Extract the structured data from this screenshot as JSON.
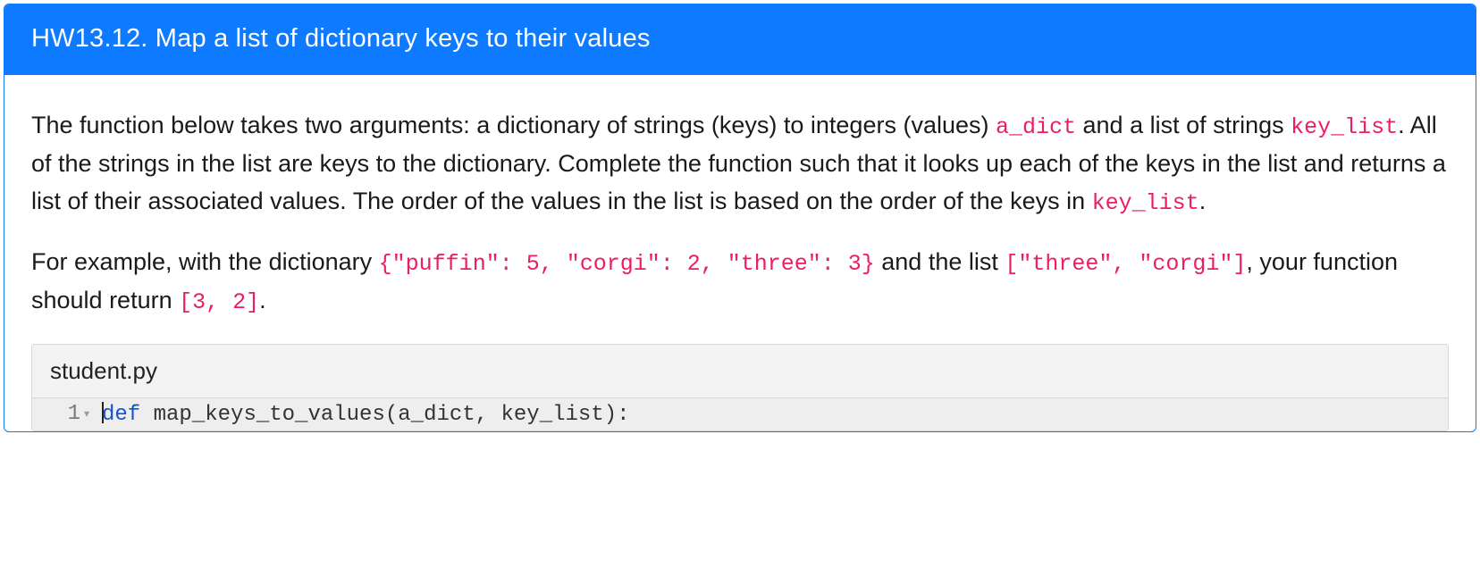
{
  "header": {
    "title": "HW13.12. Map a list of dictionary keys to their values"
  },
  "desc": {
    "p1_pre": "The function below takes two arguments: a dictionary of strings (keys) to integers (values) ",
    "code_a_dict": "a_dict",
    "p1_mid1": " and a list of strings ",
    "code_key_list": "key_list",
    "p1_mid2": ". All of the strings in the list are keys to the dictionary. Complete the function such that it looks up each of the keys in the list and returns a list of their associated values. The order of the values in the list is based on the order of the keys in ",
    "code_key_list2": "key_list",
    "p1_end": ".",
    "p2_pre": "For example, with the dictionary ",
    "code_dict_example": "{\"puffin\": 5, \"corgi\": 2, \"three\": 3}",
    "p2_mid": " and the list ",
    "code_list_example": "[\"three\", \"corgi\"]",
    "p2_mid2": ", your function should return ",
    "code_return": "[3, 2]",
    "p2_end": "."
  },
  "editor": {
    "filename": "student.py",
    "line_number": "1",
    "kw_def": "def",
    "code_rest": " map_keys_to_values(a_dict, key_list):"
  }
}
